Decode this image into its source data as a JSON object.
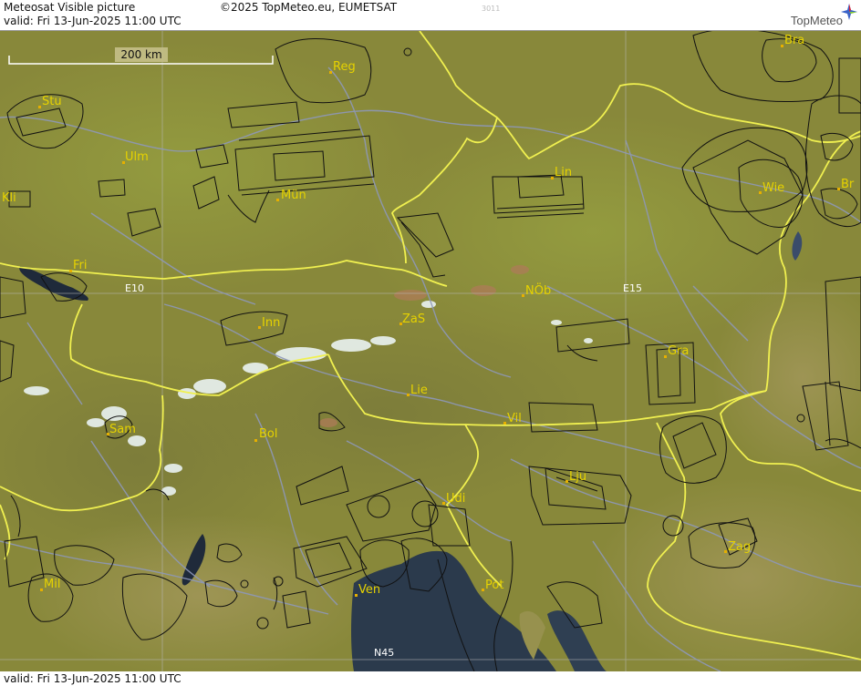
{
  "header": {
    "title": "Meteosat Visible picture",
    "valid": "valid:  Fri  13-Jun-2025  11:00 UTC",
    "copyright": "©2025 TopMeteo.eu, EUMETSAT",
    "code": "3011",
    "logo": "TopMeteo"
  },
  "footer": {
    "valid": "valid:  Fri  13-Jun-2025  11:00 UTC"
  },
  "map": {
    "scale_label": "200 km",
    "grid_labels": {
      "e10": "E10",
      "e15": "E15",
      "n45": "N45"
    },
    "places": [
      {
        "key": "reg",
        "label": "Reg"
      },
      {
        "key": "bra",
        "label": "Bra"
      },
      {
        "key": "stu",
        "label": "Stu"
      },
      {
        "key": "ulm",
        "label": "Ulm"
      },
      {
        "key": "mun",
        "label": "Mün"
      },
      {
        "key": "kli",
        "label": "Kli"
      },
      {
        "key": "lin",
        "label": "Lin"
      },
      {
        "key": "wie",
        "label": "Wie"
      },
      {
        "key": "br",
        "label": "Br"
      },
      {
        "key": "fri",
        "label": "Fri"
      },
      {
        "key": "nob",
        "label": "NÖb"
      },
      {
        "key": "inn",
        "label": "Inn"
      },
      {
        "key": "zas",
        "label": "ZaS"
      },
      {
        "key": "gra",
        "label": "Gra"
      },
      {
        "key": "lie",
        "label": "Lie"
      },
      {
        "key": "vil",
        "label": "Vil"
      },
      {
        "key": "sam",
        "label": "Sam"
      },
      {
        "key": "bol",
        "label": "Bol"
      },
      {
        "key": "lju",
        "label": "Lju"
      },
      {
        "key": "udi",
        "label": "Udi"
      },
      {
        "key": "zag",
        "label": "Zag"
      },
      {
        "key": "mil",
        "label": "Mil"
      },
      {
        "key": "ven",
        "label": "Ven"
      },
      {
        "key": "pot",
        "label": "Pot"
      }
    ],
    "colors": {
      "land": "#8a8a3a",
      "sea": "#2b3a4c",
      "border": "#f0f050",
      "rivers": "#8a95b8",
      "airspace": "#111111",
      "label": "#e6d200",
      "snow": "#e8f2f2"
    }
  }
}
